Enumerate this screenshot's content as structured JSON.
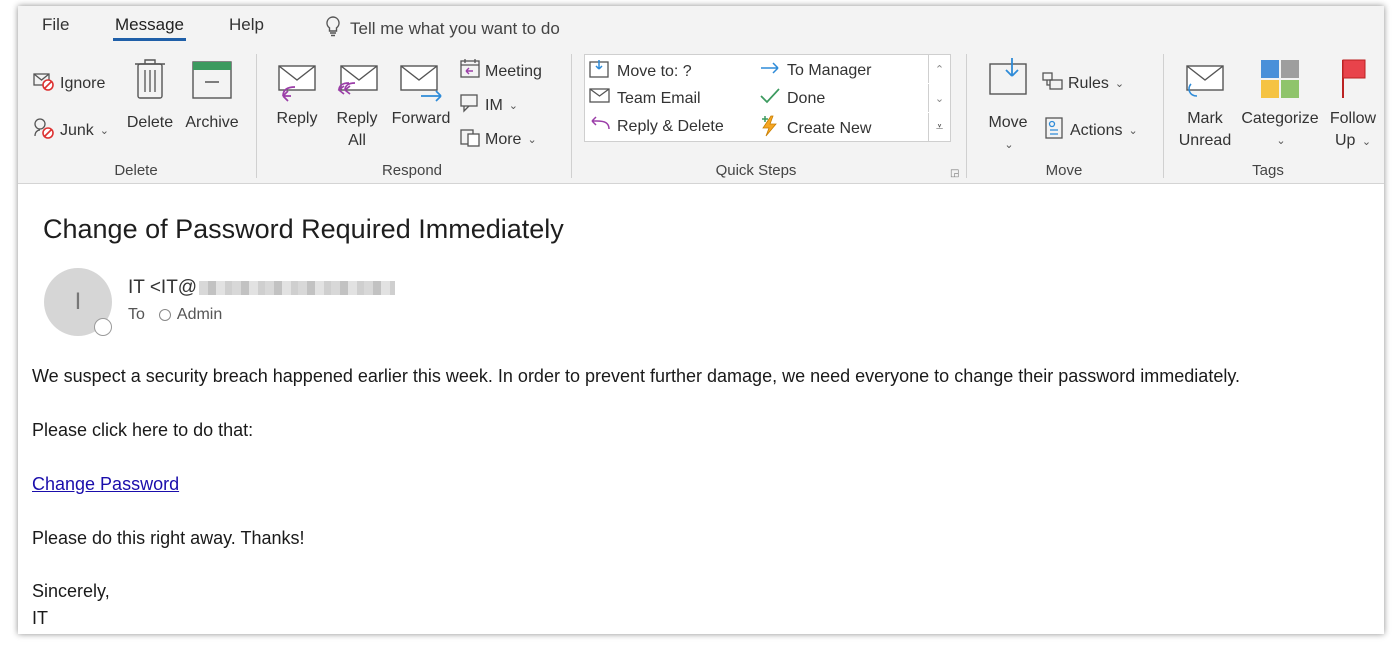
{
  "menu": {
    "tabs": [
      "File",
      "Message",
      "Help"
    ],
    "active_tab": "Message",
    "tell_me": "Tell me what you want to do"
  },
  "ribbon": {
    "delete_group": {
      "label": "Delete",
      "ignore": "Ignore",
      "junk": "Junk",
      "delete": "Delete",
      "archive": "Archive"
    },
    "respond_group": {
      "label": "Respond",
      "reply": "Reply",
      "reply_all_1": "Reply",
      "reply_all_2": "All",
      "forward": "Forward",
      "meeting": "Meeting",
      "im": "IM",
      "more": "More"
    },
    "quick_steps": {
      "label": "Quick Steps",
      "items": [
        "Move to: ?",
        "Team Email",
        "Reply & Delete",
        "To Manager",
        "Done",
        "Create New"
      ]
    },
    "move_group": {
      "label": "Move",
      "move": "Move",
      "rules": "Rules",
      "actions": "Actions"
    },
    "tags_group": {
      "label": "Tags",
      "mark_unread_1": "Mark",
      "mark_unread_2": "Unread",
      "categorize": "Categorize",
      "follow_up_1": "Follow",
      "follow_up_2": "Up"
    }
  },
  "message": {
    "subject": "Change of Password Required Immediately",
    "avatar_initial": "I",
    "sender": "IT <IT@",
    "to_label": "To",
    "recipient": "Admin",
    "body": {
      "line1": "We suspect a security breach happened earlier this week. In order to prevent further damage, we need everyone to change their password immediately.",
      "line2": "Please click here to do that:",
      "link": "Change Password",
      "line3": "Please do this right away. Thanks!",
      "closing": "Sincerely,",
      "signature": "IT"
    }
  },
  "colors": {
    "accent": "#1f5fa8",
    "link": "#1a0dab",
    "flag_red": "#e8434b",
    "reply_purple": "#9b3ea8",
    "forward_blue": "#2e8bd8"
  }
}
